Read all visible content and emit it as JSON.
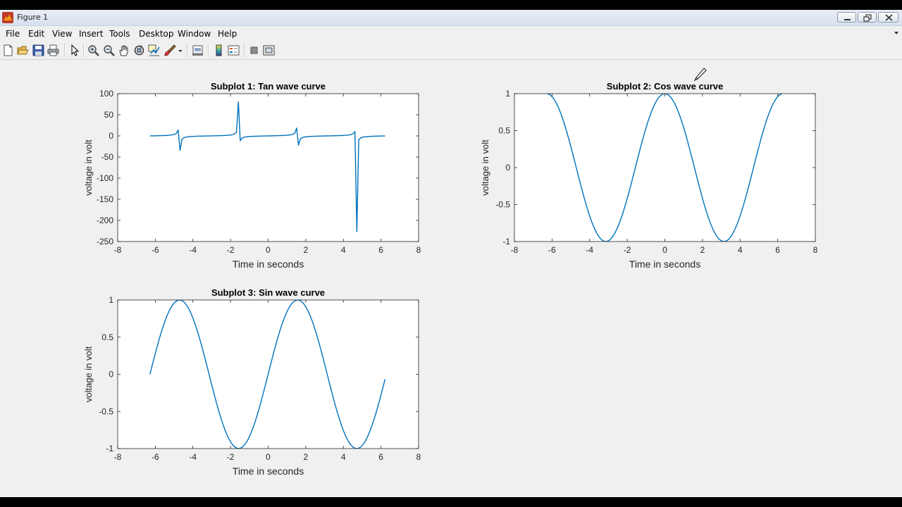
{
  "window": {
    "title": "Figure 1"
  },
  "menu": [
    "File",
    "Edit",
    "View",
    "Insert",
    "Tools",
    "Desktop",
    "Window",
    "Help"
  ],
  "toolbar_icons": [
    "new-figure-icon",
    "open-file-icon",
    "save-icon",
    "print-icon",
    "pointer-icon",
    "zoom-in-icon",
    "zoom-out-icon",
    "pan-icon",
    "rotate-3d-icon",
    "data-cursor-icon",
    "brush-icon",
    "link-plot-icon",
    "colorbar-icon",
    "legend-icon",
    "hide-plot-tools-icon",
    "show-plot-tools-icon"
  ],
  "colors": {
    "line": "#0072bd",
    "axes_bg": "#ffffff",
    "figure_bg": "#f0f0f0"
  },
  "chart_data": [
    {
      "type": "line",
      "title": "Subplot 1: Tan wave curve",
      "xlabel": "Time in seconds",
      "ylabel": "voltage in volt",
      "xlim": [
        -8,
        8
      ],
      "ylim": [
        -250,
        100
      ],
      "xticks": [
        -8,
        -6,
        -4,
        -2,
        0,
        2,
        4,
        6,
        8
      ],
      "yticks": [
        100,
        50,
        0,
        -50,
        -100,
        -150,
        -200,
        -250
      ],
      "function": "tan",
      "x_range": [
        -6.2832,
        6.2832
      ],
      "sample_step": 0.1,
      "series": [
        {
          "values_from": "tan(x)"
        }
      ]
    },
    {
      "type": "line",
      "title": "Subplot 2: Cos wave curve",
      "xlabel": "Time in seconds",
      "ylabel": "voltage in volt",
      "xlim": [
        -8,
        8
      ],
      "ylim": [
        -1,
        1
      ],
      "xticks": [
        -8,
        -6,
        -4,
        -2,
        0,
        2,
        4,
        6,
        8
      ],
      "yticks": [
        1,
        0.5,
        0,
        -0.5,
        -1
      ],
      "function": "cos",
      "x_range": [
        -6.2832,
        6.2832
      ],
      "sample_step": 0.1,
      "series": [
        {
          "values_from": "cos(x)"
        }
      ]
    },
    {
      "type": "line",
      "title": "Subplot 3: Sin wave curve",
      "xlabel": "Time in seconds",
      "ylabel": "voltage in volt",
      "xlim": [
        -8,
        8
      ],
      "ylim": [
        -1,
        1
      ],
      "xticks": [
        -8,
        -6,
        -4,
        -2,
        0,
        2,
        4,
        6,
        8
      ],
      "yticks": [
        1,
        0.5,
        0,
        -0.5,
        -1
      ],
      "function": "sin",
      "x_range": [
        -6.2832,
        6.2832
      ],
      "sample_step": 0.1,
      "series": [
        {
          "values_from": "sin(x)"
        }
      ]
    }
  ]
}
